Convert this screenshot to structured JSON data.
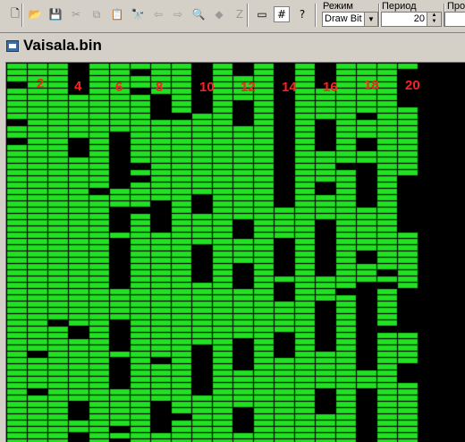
{
  "toolbar": {
    "buttons": [
      {
        "icon": "new-file-icon",
        "glyph": "🗋",
        "enabled": true
      },
      {
        "icon": "open-folder-icon",
        "glyph": "📂",
        "enabled": true
      },
      {
        "icon": "save-icon",
        "glyph": "💾",
        "enabled": false
      },
      {
        "icon": "cut-icon",
        "glyph": "✂",
        "enabled": false
      },
      {
        "icon": "copy-icon",
        "glyph": "⧉",
        "enabled": false
      },
      {
        "icon": "paste-icon",
        "glyph": "📋",
        "enabled": false
      },
      {
        "icon": "find-icon",
        "glyph": "🔭",
        "enabled": true
      },
      {
        "icon": "back-arrow-icon",
        "glyph": "⇦",
        "enabled": false
      },
      {
        "icon": "forward-arrow-icon",
        "glyph": "⇨",
        "enabled": false
      },
      {
        "icon": "find-page-icon",
        "glyph": "🔍",
        "enabled": false
      },
      {
        "icon": "fill-icon",
        "glyph": "◆",
        "enabled": false
      },
      {
        "icon": "zoom-icon",
        "glyph": "Z",
        "enabled": false
      },
      {
        "icon": "rectangle-icon",
        "glyph": "▭",
        "enabled": true
      },
      {
        "icon": "grid-icon",
        "glyph": "#",
        "enabled": true,
        "active": true
      },
      {
        "icon": "help-icon",
        "glyph": "?",
        "enabled": true
      }
    ],
    "mode_label": "Режим",
    "mode_value": "Draw Bit",
    "period_label": "Период",
    "period_value": "20",
    "extra_label": "Прок"
  },
  "document": {
    "title": "Vaisala.bin"
  },
  "bit_canvas": {
    "column_labels": [
      "2",
      "4",
      "6",
      "8",
      "10",
      "12",
      "14",
      "16",
      "18",
      "20"
    ],
    "period": 20,
    "colors": {
      "on": "#22e022",
      "grid": "#0a5a0a",
      "background": "#000000",
      "label": "#ff2020"
    }
  }
}
